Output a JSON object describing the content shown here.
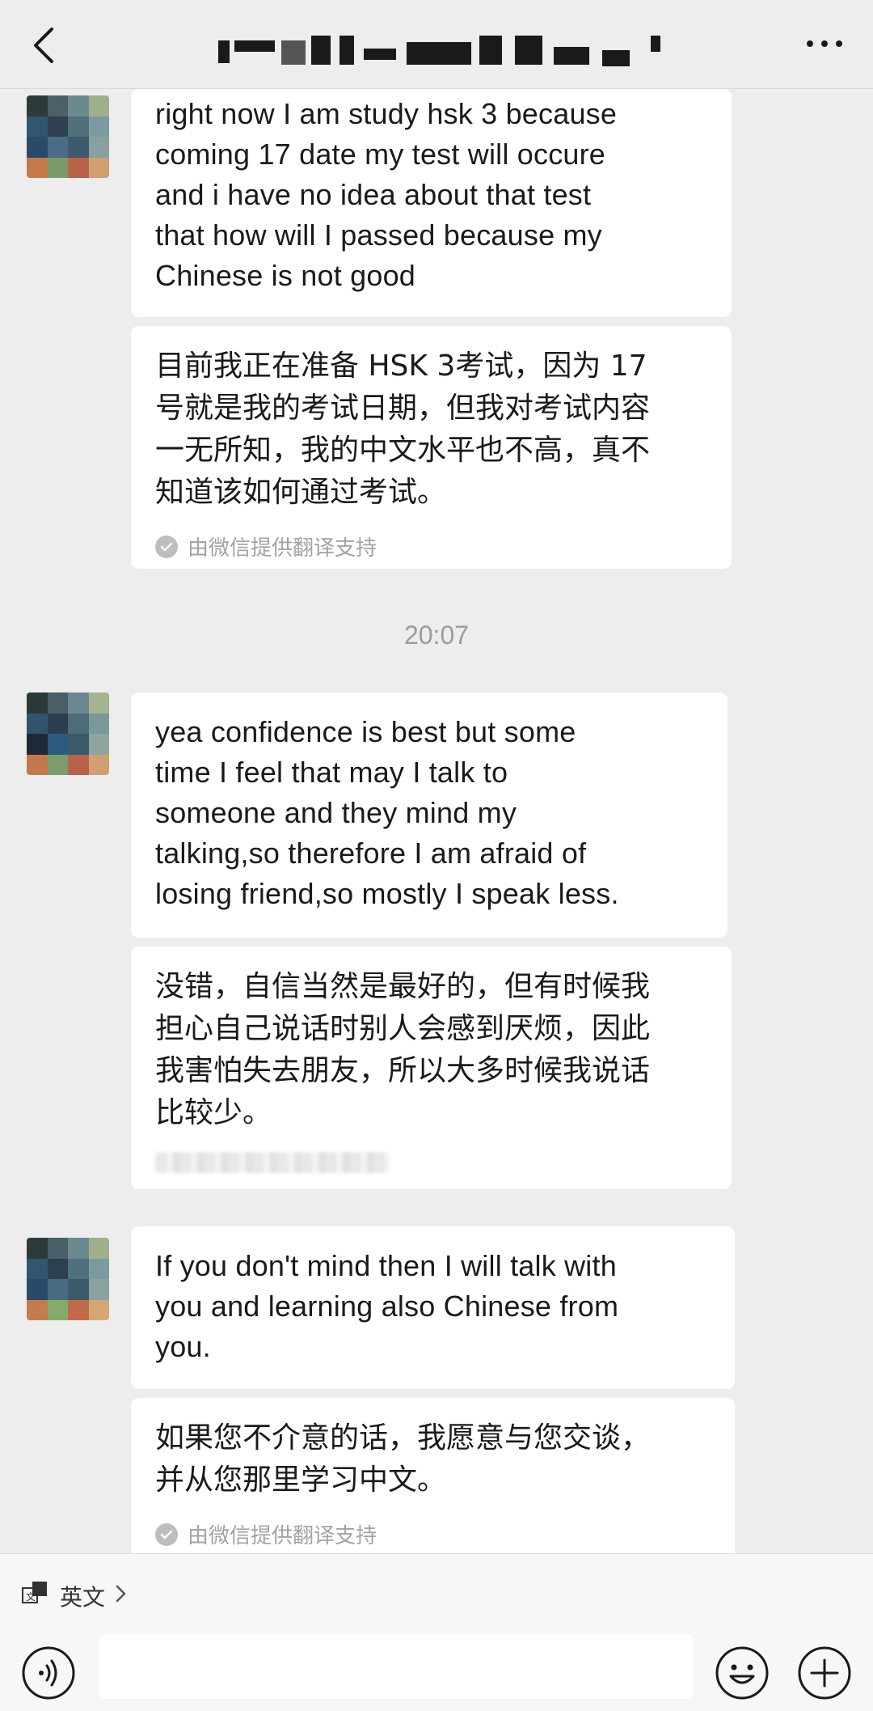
{
  "header": {
    "title_redacted": true
  },
  "messages": [
    {
      "english": "right now I am study hsk 3 because coming 17 date my test will occure and i have no idea about that test that how will I passed because my Chinese is not good",
      "lines": [
        "right now I am study hsk 3 because",
        "coming 17 date my test will occure",
        "and i have no idea about that test",
        "that how will I passed because my",
        "Chinese is not good"
      ],
      "translation_lines": [
        "目前我正在准备 HSK 3考试，因为 17",
        "号就是我的考试日期，但我对考试内容",
        "一无所知，我的中文水平也不高，真不",
        "知道该如何通过考试。"
      ],
      "credit": "由微信提供翻译支持"
    },
    {
      "lines": [
        "yea confidence is best but some",
        "time I feel that may I talk to",
        "someone and they mind my",
        "talking,so therefore I am afraid of",
        "losing friend,so mostly I speak less."
      ],
      "translation_lines": [
        "没错，自信当然是最好的，但有时候我",
        "担心自己说话时别人会感到厌烦，因此",
        "我害怕失去朋友，所以大多时候我说话",
        "比较少。"
      ]
    },
    {
      "lines": [
        "If you don't mind then I will talk with",
        "you and learning also Chinese from",
        "you."
      ],
      "translation_lines": [
        "如果您不介意的话，我愿意与您交谈，",
        "并从您那里学习中文。"
      ],
      "credit": "由微信提供翻译支持"
    }
  ],
  "timestamp": "20:07",
  "language_bar": {
    "label": "英文"
  },
  "input": {
    "value": ""
  },
  "icons": {
    "back": "chevron-left-icon",
    "more": "more-dots-icon",
    "translate": "translate-icon",
    "voice": "voice-icon",
    "emoji": "emoji-icon",
    "plus": "plus-icon"
  }
}
